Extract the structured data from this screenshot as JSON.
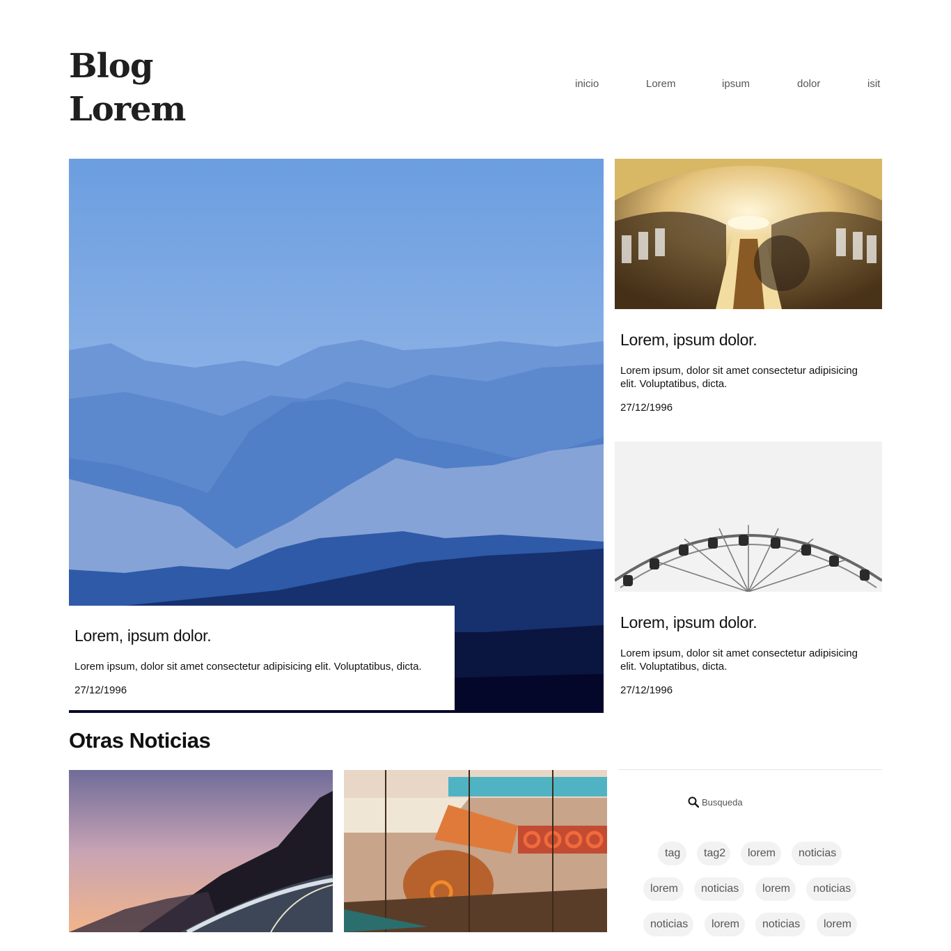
{
  "header": {
    "logo_line1": "Blog",
    "logo_line2": "Lorem"
  },
  "nav": {
    "items": [
      "inicio",
      "Lorem",
      "ipsum",
      "dolor",
      "isit"
    ]
  },
  "featured": {
    "title": "Lorem, ipsum dolor.",
    "body": "Lorem ipsum, dolor sit amet consectetur adipisicing elit. Voluptatibus, dicta.",
    "date": "27/12/1996"
  },
  "side_cards": [
    {
      "title": "Lorem, ipsum dolor.",
      "body": "Lorem ipsum, dolor sit amet consectetur adipisicing elit. Voluptatibus, dicta.",
      "date": "27/12/1996"
    },
    {
      "title": "Lorem, ipsum dolor.",
      "body": "Lorem ipsum, dolor sit amet consectetur adipisicing elit. Voluptatibus, dicta.",
      "date": "27/12/1996"
    }
  ],
  "other_news": {
    "title": "Otras Noticias"
  },
  "sidebar": {
    "search_placeholder": "Busqueda",
    "tags": [
      "tag",
      "tag2",
      "lorem",
      "noticias",
      "lorem",
      "noticias",
      "lorem",
      "noticias",
      "noticias",
      "lorem",
      "noticias",
      "lorem"
    ]
  },
  "colors": {
    "accent_text": "#111111",
    "nav_text": "#555555",
    "tag_bg": "#f2f2f2"
  }
}
